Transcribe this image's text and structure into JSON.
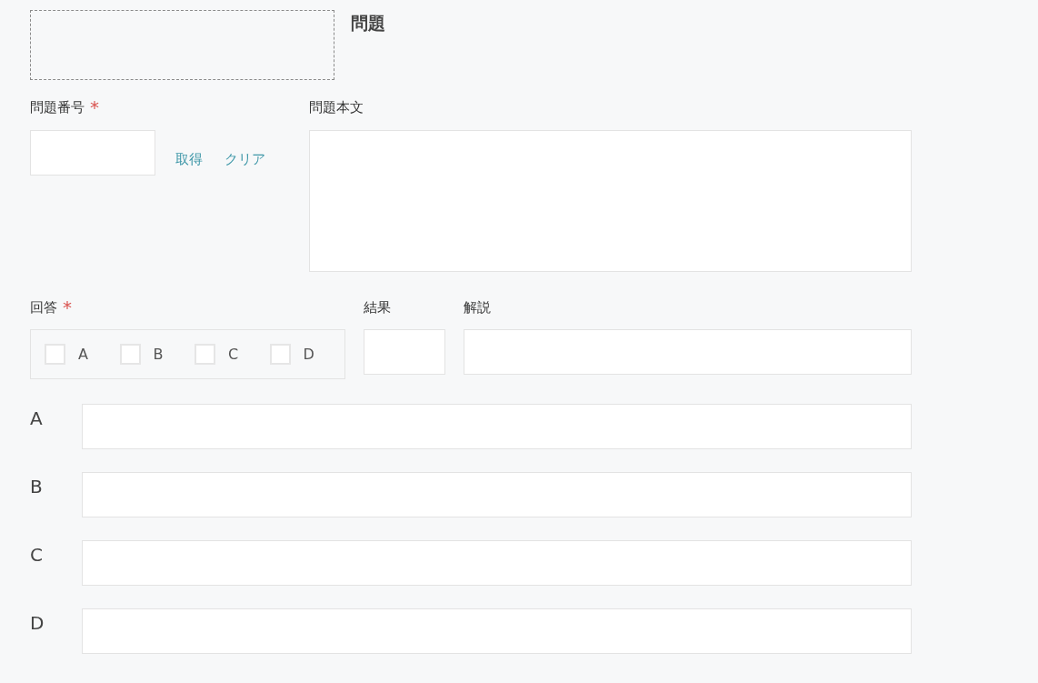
{
  "title": "問題",
  "question_number": {
    "label": "問題番号",
    "required_mark": "*",
    "links": [
      "取得",
      "クリア"
    ]
  },
  "question_text": {
    "label": "問題本文"
  },
  "answer": {
    "label": "回答",
    "required_mark": "*",
    "options": [
      {
        "label": "A",
        "checked": false
      },
      {
        "label": "B",
        "checked": false
      },
      {
        "label": "C",
        "checked": false
      },
      {
        "label": "D",
        "checked": false
      }
    ]
  },
  "result": {
    "label": "結果"
  },
  "explanation": {
    "label": "解説"
  },
  "choices": [
    {
      "label": "A"
    },
    {
      "label": "B"
    },
    {
      "label": "C"
    },
    {
      "label": "D"
    }
  ]
}
